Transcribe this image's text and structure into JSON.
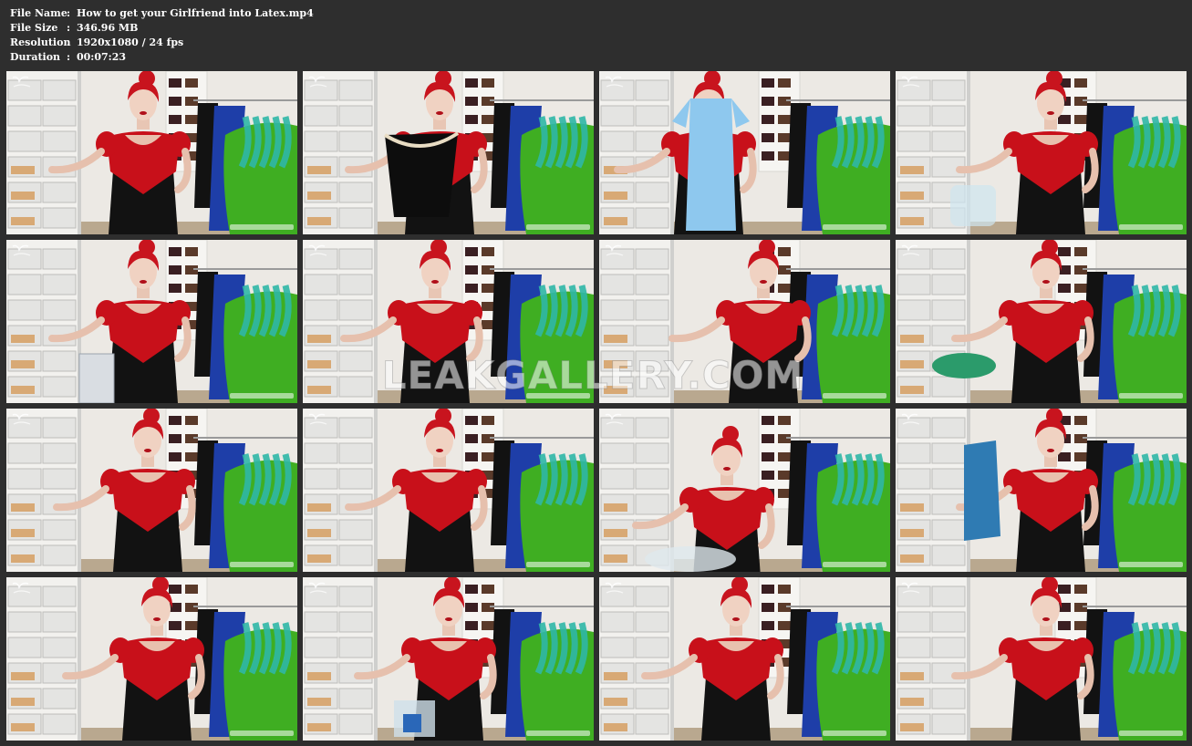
{
  "file_info": {
    "rows": [
      {
        "key": "File Name",
        "sep": ":",
        "value": "How to get your Girlfriend into Latex.mp4"
      },
      {
        "key": "File Size",
        "sep": ":",
        "value": "346.96 MB"
      },
      {
        "key": "Resolution",
        "sep": ":",
        "value": "1920x1080 / 24 fps"
      },
      {
        "key": "Duration",
        "sep": ":",
        "value": "00:07:23"
      }
    ]
  },
  "thumbnails": {
    "count": 16,
    "columns": 4,
    "rows": 4
  },
  "colors": {
    "background": "#2e2e2e",
    "info_text": "#ffffff",
    "latex_red": "#c8101a",
    "latex_black": "#121212",
    "hair_red": "#c8141e",
    "green_garment": "#3fae22",
    "teal_garment": "#2fb7a6",
    "blue_garment": "#1e3ea8",
    "light_blue_garment": "#8ec8ee",
    "wall": "#ece9e4",
    "shelf": "#f2f1ee"
  },
  "watermark": {
    "overlay_text": "LEAKGALLERY.COM"
  }
}
